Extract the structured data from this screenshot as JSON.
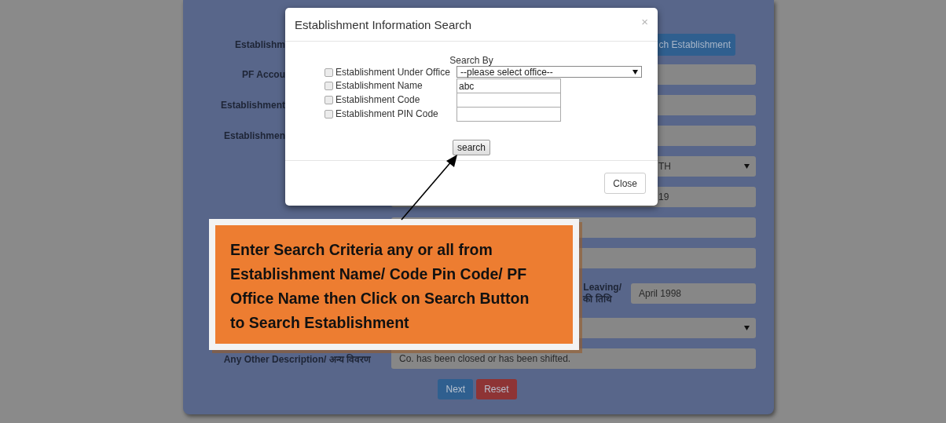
{
  "form": {
    "rows": [
      {
        "kind": "cut",
        "label": "Establishm",
        "control": {
          "kind": "button",
          "text": "ch Establishment"
        }
      },
      {
        "kind": "cut",
        "label": "PF Accou",
        "control": {
          "kind": "input"
        }
      },
      {
        "kind": "cut",
        "label": "Establishment",
        "control": {
          "kind": "input"
        }
      },
      {
        "kind": "cut",
        "label": "Establishmen",
        "control": {
          "kind": "input"
        }
      },
      {
        "kind": "hidden",
        "control": {
          "kind": "select",
          "value": "TH"
        }
      },
      {
        "kind": "hidden",
        "control": {
          "kind": "input",
          "value": "19"
        }
      },
      {
        "kind": "hidden",
        "control": {
          "kind": "input"
        }
      },
      {
        "kind": "hidden",
        "control": {
          "kind": "input"
        }
      },
      {
        "kind": "pair",
        "label": "Leaving/",
        "label_2": "की तिथि",
        "control": {
          "kind": "input",
          "value": "April 1998"
        }
      },
      {
        "kind": "hidden",
        "control": {
          "kind": "select"
        }
      },
      {
        "kind": "label",
        "label": "Any Other Description/ अन्य विवरण",
        "control": {
          "kind": "input",
          "value": "Co. has been closed or has been shifted."
        }
      }
    ],
    "buttons": [
      {
        "kind": "primary",
        "label": "Next"
      },
      {
        "kind": "danger",
        "label": "Reset"
      }
    ]
  },
  "modal": {
    "title": "Establishment Information Search",
    "close_symbol": "×",
    "heading": "Search By",
    "criteria": [
      {
        "label": "Establishment Under Office",
        "checked": false,
        "field": {
          "kind": "select",
          "value": "--please select office--"
        }
      },
      {
        "label": "Establishment Name",
        "checked": false,
        "field": {
          "kind": "input",
          "value": "abc"
        }
      },
      {
        "label": "Establishment Code",
        "checked": false,
        "field": {
          "kind": "input"
        }
      },
      {
        "label": "Establishment PIN Code",
        "checked": false,
        "field": {
          "kind": "input"
        }
      }
    ],
    "search_button": "search",
    "close_button": "Close"
  },
  "callout": {
    "text": "Enter Search Criteria any or all from Establishment Name/ Code Pin Code/ PF Office Name then Click on Search Button to Search Establishment"
  }
}
